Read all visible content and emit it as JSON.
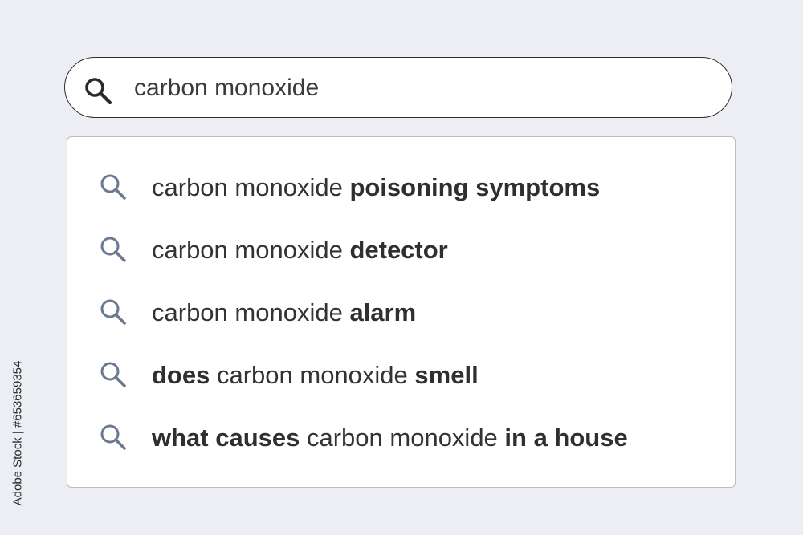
{
  "search": {
    "query": "carbon monoxide",
    "icon": "search-icon"
  },
  "suggestions": [
    {
      "icon": "search-icon",
      "parts": [
        {
          "text": "carbon monoxide ",
          "bold": false
        },
        {
          "text": "poisoning symptoms",
          "bold": true
        }
      ]
    },
    {
      "icon": "search-icon",
      "parts": [
        {
          "text": "carbon monoxide ",
          "bold": false
        },
        {
          "text": "detector",
          "bold": true
        }
      ]
    },
    {
      "icon": "search-icon",
      "parts": [
        {
          "text": "carbon monoxide ",
          "bold": false
        },
        {
          "text": "alarm",
          "bold": true
        }
      ]
    },
    {
      "icon": "search-icon",
      "parts": [
        {
          "text": "does",
          "bold": true
        },
        {
          "text": " carbon monoxide ",
          "bold": false
        },
        {
          "text": "smell",
          "bold": true
        }
      ]
    },
    {
      "icon": "search-icon",
      "parts": [
        {
          "text": "what causes",
          "bold": true
        },
        {
          "text": " carbon monoxide ",
          "bold": false
        },
        {
          "text": "in a house",
          "bold": true
        }
      ]
    }
  ],
  "stock_id": "Adobe Stock | #653659354",
  "colors": {
    "background": "#eceef3",
    "search_icon_dark": "#2b2b2b",
    "suggestion_icon": "#6b7a90",
    "text": "#333333"
  }
}
